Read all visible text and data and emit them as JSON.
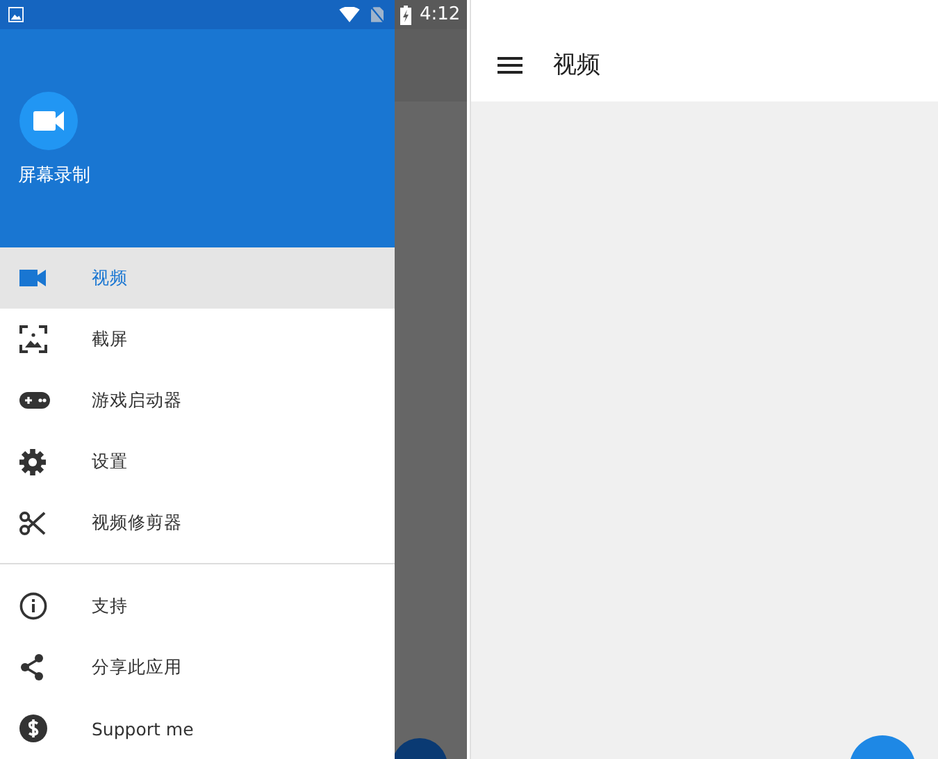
{
  "status_bar": {
    "time": "4:12"
  },
  "drawer": {
    "app_name": "屏幕录制",
    "groups": [
      {
        "items": [
          {
            "kind": "video",
            "label": "视频",
            "selected": true
          },
          {
            "kind": "screenshot",
            "label": "截屏",
            "selected": false
          },
          {
            "kind": "gamepad",
            "label": "游戏启动器",
            "selected": false
          },
          {
            "kind": "settings",
            "label": "设置",
            "selected": false
          },
          {
            "kind": "scissors",
            "label": "视频修剪器",
            "selected": false
          }
        ]
      },
      {
        "items": [
          {
            "kind": "info",
            "label": "支持",
            "selected": false
          },
          {
            "kind": "share",
            "label": "分享此应用",
            "selected": false
          },
          {
            "kind": "dollar",
            "label": "Support me",
            "selected": false
          }
        ]
      }
    ]
  },
  "toolbar": {
    "title": "视频"
  }
}
